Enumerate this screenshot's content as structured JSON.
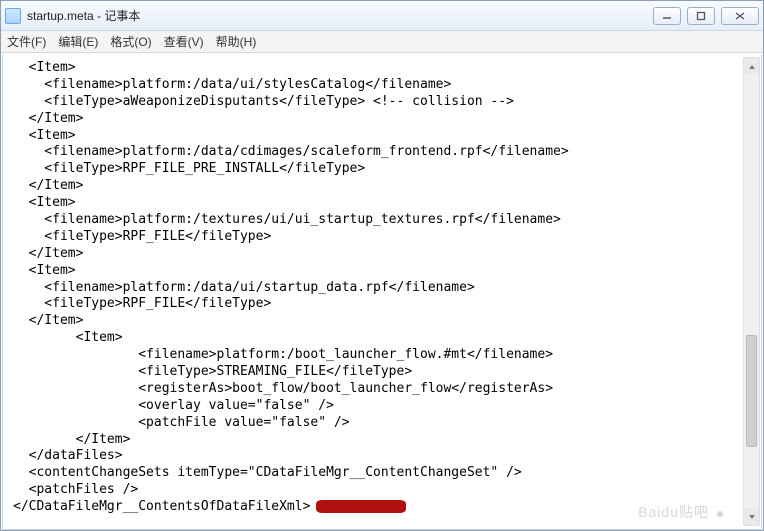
{
  "window": {
    "title": "startup.meta - 记事本"
  },
  "menu": {
    "file": "文件(F)",
    "edit": "编辑(E)",
    "format": "格式(O)",
    "view": "查看(V)",
    "help": "帮助(H)"
  },
  "watermark": "Baidu贴吧",
  "code": {
    "lines": [
      "  <Item>",
      "    <filename>platform:/data/ui/stylesCatalog</filename>",
      "    <fileType>aWeaponizeDisputants</fileType> <!-- collision -->",
      "  </Item>",
      "  <Item>",
      "    <filename>platform:/data/cdimages/scaleform_frontend.rpf</filename>",
      "    <fileType>RPF_FILE_PRE_INSTALL</fileType>",
      "  </Item>",
      "  <Item>",
      "    <filename>platform:/textures/ui/ui_startup_textures.rpf</filename>",
      "    <fileType>RPF_FILE</fileType>",
      "  </Item>",
      "  <Item>",
      "    <filename>platform:/data/ui/startup_data.rpf</filename>",
      "    <fileType>RPF_FILE</fileType>",
      "  </Item>",
      "        <Item>",
      "                <filename>platform:/boot_launcher_flow.#mt</filename>",
      "                <fileType>STREAMING_FILE</fileType>",
      "                <registerAs>boot_flow/boot_launcher_flow</registerAs>",
      "                <overlay value=\"false\" />",
      "                <patchFile value=\"false\" />",
      "        </Item>",
      "  </dataFiles>",
      "  <contentChangeSets itemType=\"CDataFileMgr__ContentChangeSet\" />",
      "  <patchFiles />"
    ],
    "lastLine": "</CDataFileMgr__ContentsOfDataFileXml>"
  }
}
